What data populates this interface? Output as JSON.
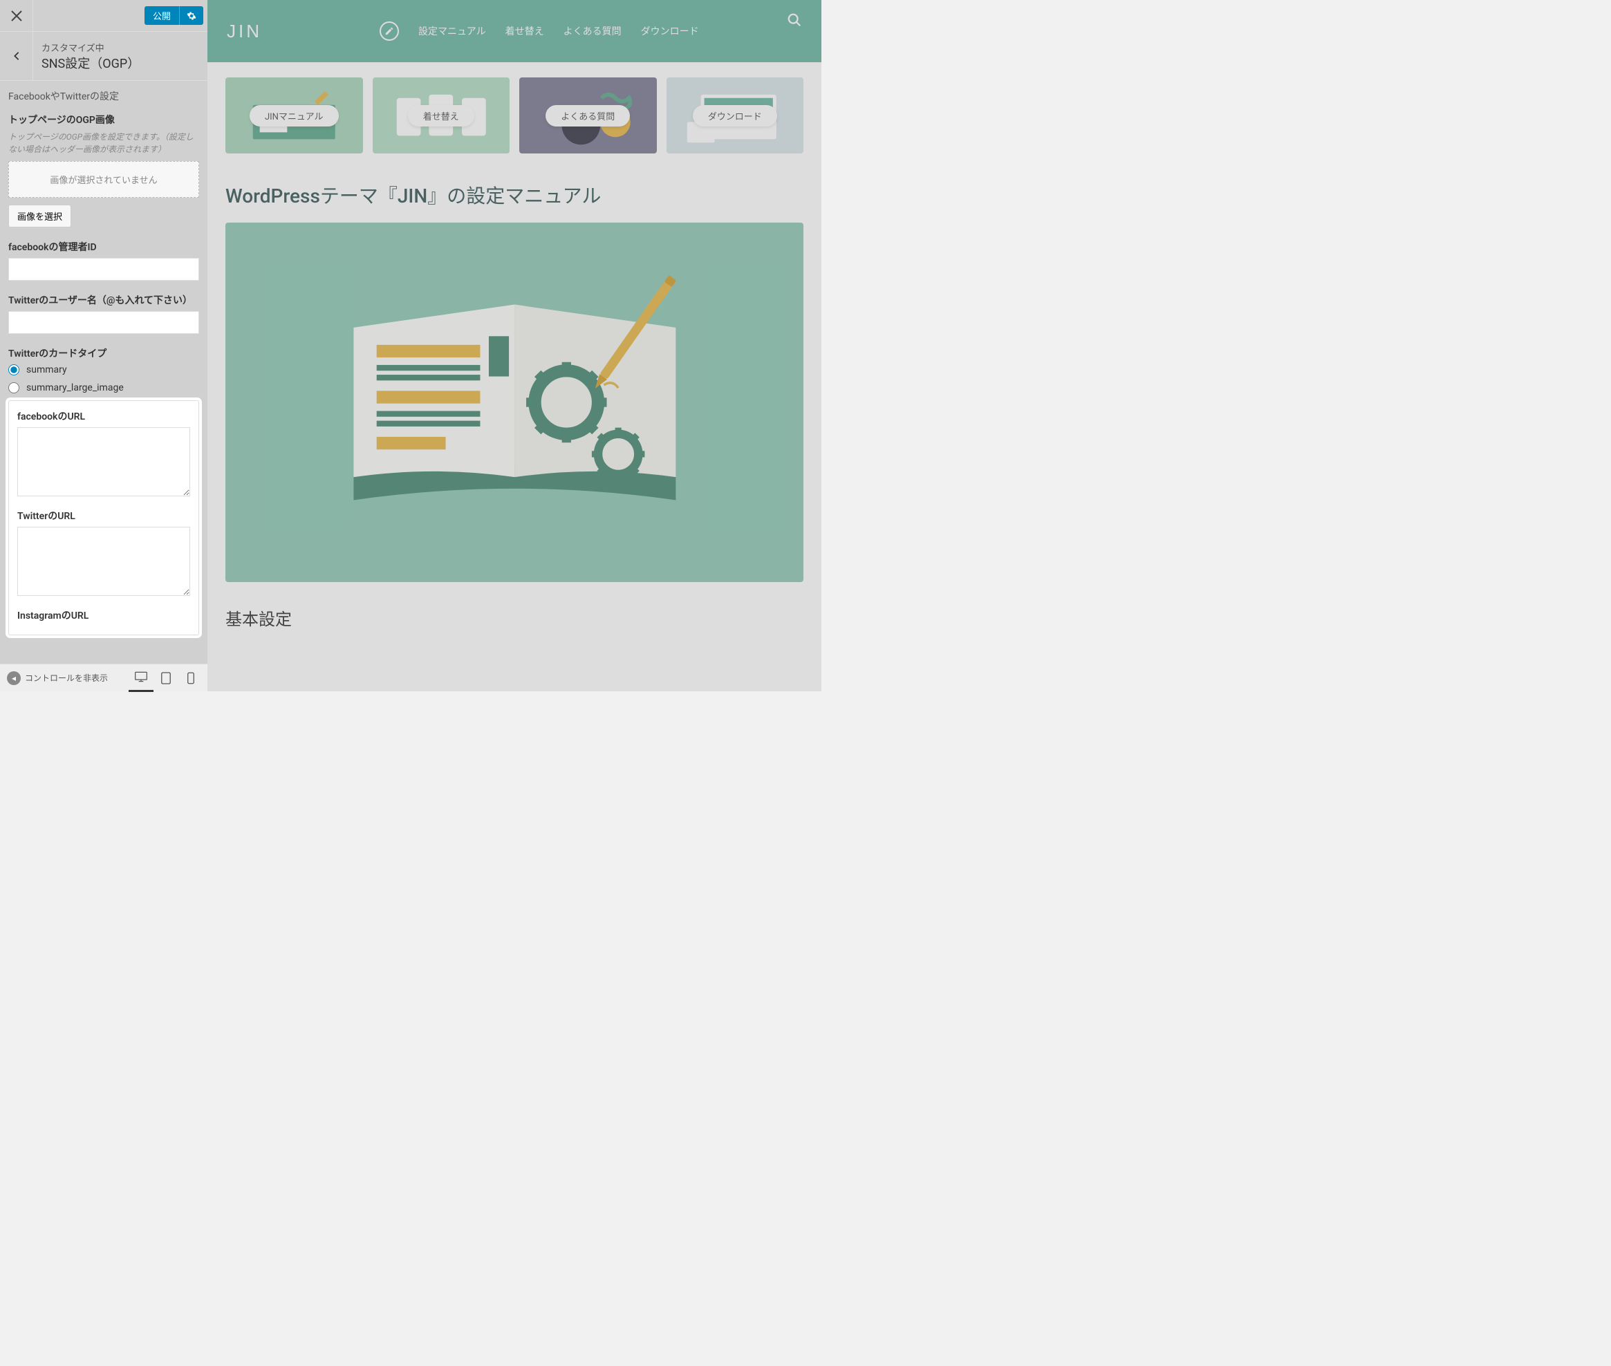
{
  "sidebar": {
    "publish_label": "公開",
    "customizing_label": "カスタマイズ中",
    "panel_title": "SNS設定（OGP）",
    "description": "FacebookやTwitterの設定",
    "ogp_image": {
      "label": "トップページのOGP画像",
      "help": "トップページのOGP画像を設定できます。（設定しない場合はヘッダー画像が表示されます）",
      "placeholder": "画像が選択されていません",
      "button": "画像を選択"
    },
    "fb_admin": {
      "label": "facebookの管理者ID",
      "value": ""
    },
    "twitter_user": {
      "label": "Twitterのユーザー名（@も入れて下さい）",
      "value": ""
    },
    "card_type": {
      "label": "Twitterのカードタイプ",
      "options": [
        "summary",
        "summary_large_image"
      ],
      "selected": "summary"
    },
    "fb_url": {
      "label": "facebookのURL",
      "value": ""
    },
    "tw_url": {
      "label": "TwitterのURL",
      "value": ""
    },
    "ig_url": {
      "label": "InstagramのURL",
      "value": ""
    },
    "footer": {
      "collapse_label": "コントロールを非表示"
    }
  },
  "preview": {
    "logo": "JIN",
    "nav": [
      "設定マニュアル",
      "着せ替え",
      "よくある質問",
      "ダウンロード"
    ],
    "cards": [
      "JINマニュアル",
      "着せ替え",
      "よくある質問",
      "ダウンロード"
    ],
    "page_title": "WordPressテーマ『JIN』の設定マニュアル",
    "section_heading": "基本設定"
  }
}
